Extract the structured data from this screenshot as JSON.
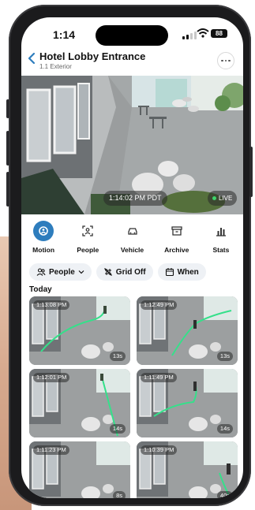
{
  "status_bar": {
    "time": "1:14",
    "battery": "88"
  },
  "header": {
    "title": "Hotel Lobby Entrance",
    "subtitle": "1.1 Exterior"
  },
  "camera": {
    "timestamp": "1:14:02 PM PDT",
    "live_label": "LIVE"
  },
  "modes": [
    {
      "label": "Motion",
      "icon": "motion-icon",
      "active": true
    },
    {
      "label": "People",
      "icon": "person-scan-icon",
      "active": false
    },
    {
      "label": "Vehicle",
      "icon": "car-icon",
      "active": false
    },
    {
      "label": "Archive",
      "icon": "archive-icon",
      "active": false
    },
    {
      "label": "Stats",
      "icon": "bar-chart-icon",
      "active": false
    }
  ],
  "filters": [
    {
      "label": "People",
      "icon": "people-icon"
    },
    {
      "label": "Grid Off",
      "icon": "grid-off-icon"
    },
    {
      "label": "When",
      "icon": "calendar-icon"
    }
  ],
  "section_label": "Today",
  "clips": [
    {
      "time": "1:13:08 PM",
      "duration": "13s"
    },
    {
      "time": "1:12:49 PM",
      "duration": "13s"
    },
    {
      "time": "1:12:01 PM",
      "duration": "14s"
    },
    {
      "time": "1:11:49 PM",
      "duration": "14s"
    },
    {
      "time": "1:11:23 PM",
      "duration": "8s"
    },
    {
      "time": "1:10:39 PM",
      "duration": "40s"
    }
  ],
  "colors": {
    "accent": "#2e7dbd",
    "track": "#35e08a",
    "live_dot": "#3ed36b"
  }
}
